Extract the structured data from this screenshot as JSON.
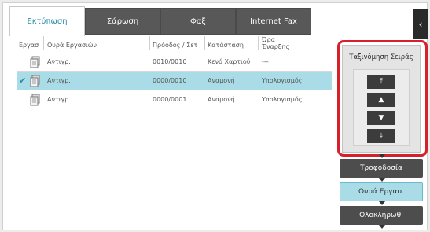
{
  "tabs": [
    {
      "label": "Εκτύπωση",
      "active": true
    },
    {
      "label": "Σάρωση",
      "active": false
    },
    {
      "label": "Φαξ",
      "active": false
    },
    {
      "label": "Internet Fax",
      "active": false
    }
  ],
  "collapse_icon": "chevron-left-icon",
  "table": {
    "headers": {
      "job": "Εργασ",
      "queue": "Ουρά Εργασιών",
      "progress": "Πρόοδος / Σετ",
      "status": "Κατάσταση",
      "start_time_line1": "Ώρα",
      "start_time_line2": "Έναρξης"
    },
    "rows": [
      {
        "selected": false,
        "queue": "Αντιγρ.",
        "progress": "0010/0010",
        "status": "Κενό Χαρτιού",
        "start": "---"
      },
      {
        "selected": true,
        "queue": "Αντιγρ.",
        "progress": "0000/0010",
        "status": "Αναμονή",
        "start": "Υπολογισμός"
      },
      {
        "selected": false,
        "queue": "Αντιγρ.",
        "progress": "0000/0001",
        "status": "Αναμονή",
        "start": "Υπολογισμός"
      }
    ]
  },
  "sort": {
    "title": "Ταξινόμηση Σειράς",
    "buttons": [
      {
        "icon": "move-to-top-icon",
        "glyph": "⤒"
      },
      {
        "icon": "move-up-icon",
        "glyph": "▲"
      },
      {
        "icon": "move-down-icon",
        "glyph": "▼"
      },
      {
        "icon": "move-to-bottom-icon",
        "glyph": "⤓"
      }
    ]
  },
  "side": {
    "supply_label": "Τροφοδοσία",
    "queue_label": "Ουρά Εργασ.",
    "complete_label": "Ολοκληρωθ."
  },
  "colors": {
    "accent": "#2a8fa8",
    "selected_row": "#a9dce6",
    "highlight_outline": "#d6202c"
  }
}
